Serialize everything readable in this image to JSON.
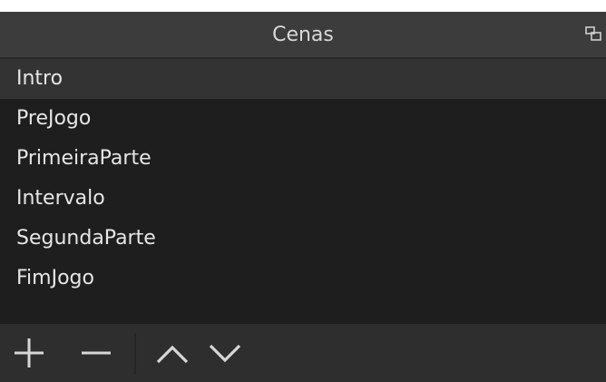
{
  "dock": {
    "title": "Cenas"
  },
  "scenes": {
    "items": [
      {
        "label": "Intro",
        "selected": true
      },
      {
        "label": "PreJogo",
        "selected": false
      },
      {
        "label": "PrimeiraParte",
        "selected": false
      },
      {
        "label": "Intervalo",
        "selected": false
      },
      {
        "label": "SegundaParte",
        "selected": false
      },
      {
        "label": "FimJogo",
        "selected": false
      }
    ]
  },
  "toolbar": {
    "icons": [
      "plus-icon",
      "minus-icon",
      "chevron-up-icon",
      "chevron-down-icon"
    ]
  },
  "colors": {
    "titlebar": "#3c3c3c",
    "list_background": "#1e1e1e",
    "selected_row": "#333333",
    "toolbar": "#2e2e2e",
    "text": "#e6e6e6"
  }
}
